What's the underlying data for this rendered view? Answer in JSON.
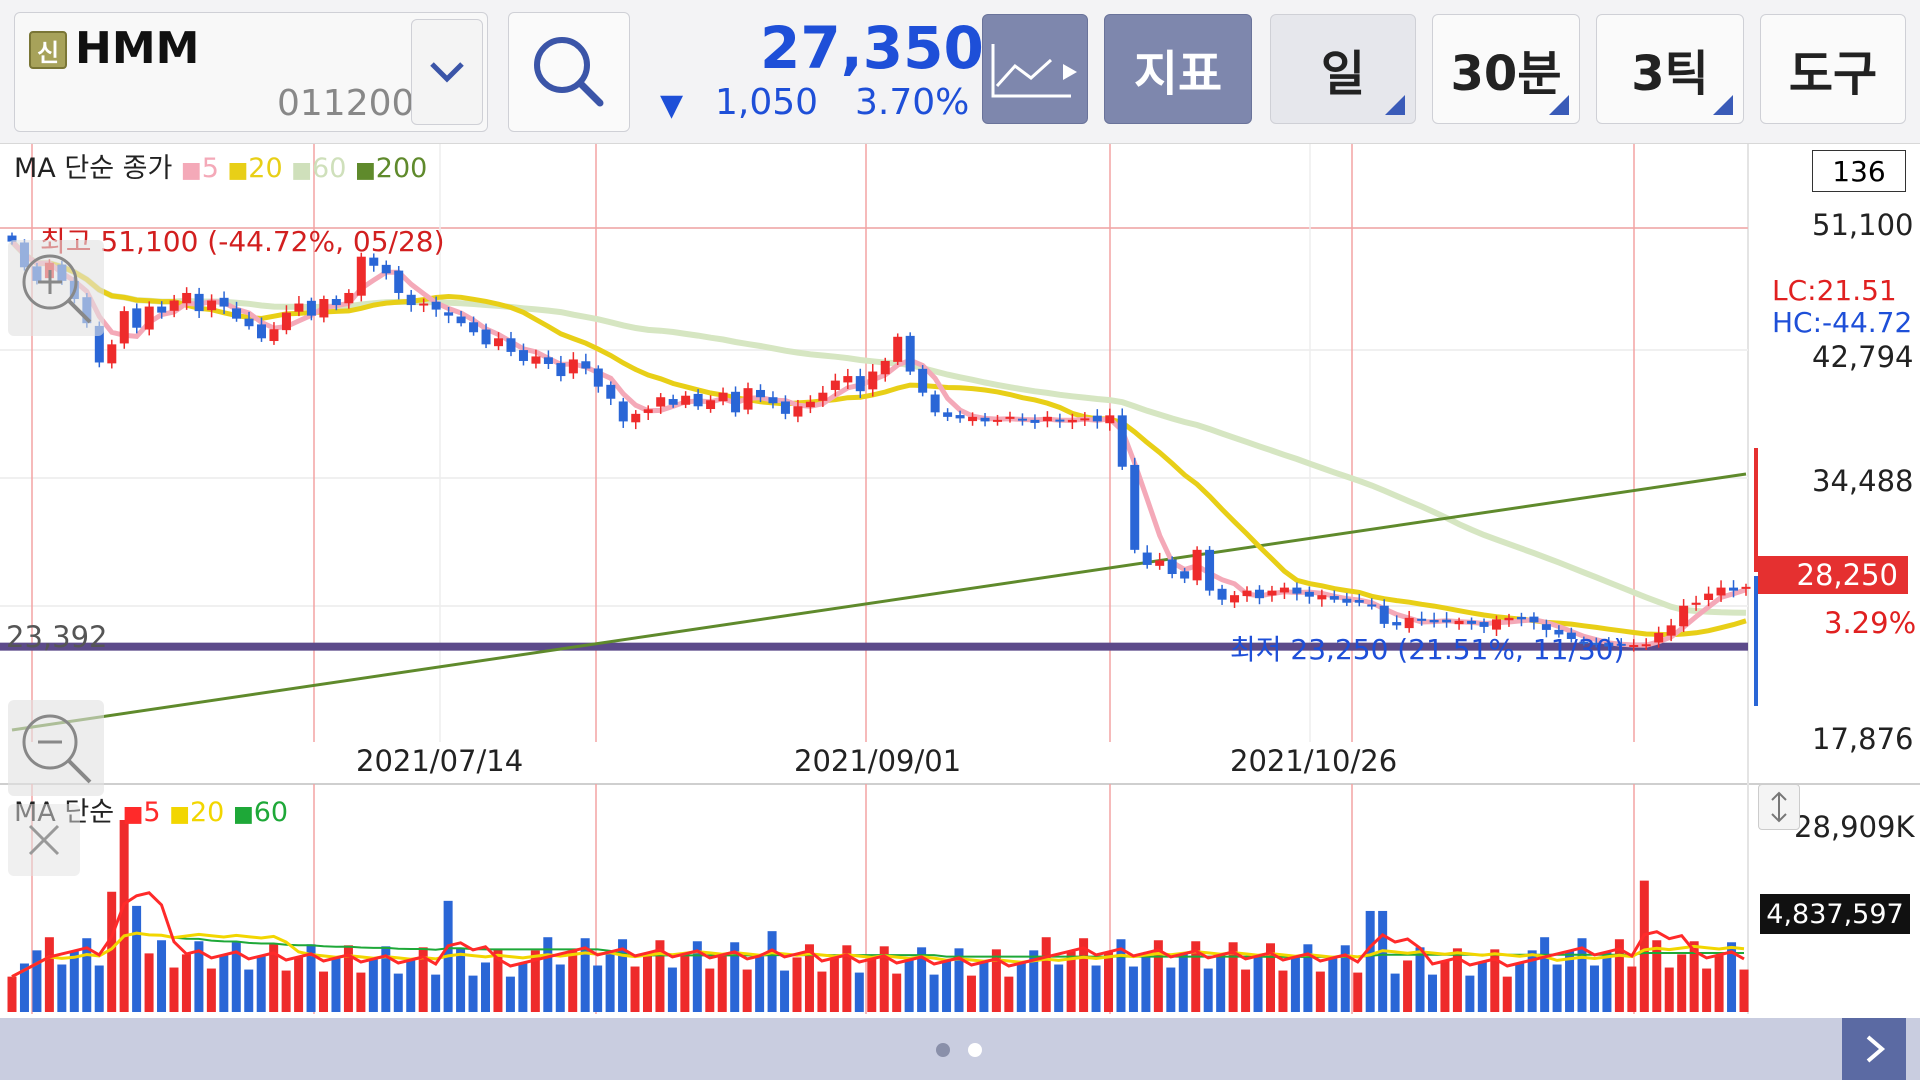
{
  "toolbar": {
    "symbol_badge": "신",
    "symbol_name": "HMM",
    "symbol_code": "011200",
    "price": "27,350",
    "direction": "▼",
    "change": "1,050",
    "change_pct": "3.70%",
    "indicator_label": "지표",
    "day_label": "일",
    "min_label": "30분",
    "tick_label": "3틱",
    "tools_label": "도구"
  },
  "price_panel": {
    "legend_title": "MA 단순 종가",
    "ma": [
      {
        "label": "5",
        "color": "#f4a9b8"
      },
      {
        "label": "20",
        "color": "#e8cf17"
      },
      {
        "label": "60",
        "color": "#d6e6c2"
      },
      {
        "label": "200",
        "color": "#5f8a2c"
      }
    ],
    "high_note": "최고 51,100 (-44.72%, 05/28)",
    "low_note": "최저 23,250 (21.51%, 11/30)",
    "hline_label": "23,392",
    "y_ticks": [
      "51,100",
      "42,794",
      "34,488",
      "17,876"
    ],
    "count_box": "136",
    "lc": "LC:21.51",
    "hc": "HC:-44.72",
    "cur_price_tag": "28,250",
    "cur_pct": "3.29%",
    "dates": [
      "2021/07/14",
      "2021/09/01",
      "2021/10/26"
    ]
  },
  "volume_panel": {
    "legend_title": "MA 단순",
    "ma": [
      {
        "label": "5",
        "color": "#ff2a2a"
      },
      {
        "label": "20",
        "color": "#f2d600"
      },
      {
        "label": "60",
        "color": "#1ea838"
      }
    ],
    "max_label": "28,909K",
    "cur_volume": "4,837,597"
  },
  "chart_data": {
    "type": "candlestick",
    "ylim": [
      17876,
      51100
    ],
    "closes": [
      50200,
      48500,
      47600,
      48800,
      47600,
      46400,
      44800,
      42200,
      43400,
      45600,
      44500,
      45900,
      45500,
      46300,
      46800,
      45600,
      46300,
      45900,
      45100,
      44600,
      43800,
      44400,
      45500,
      46100,
      45300,
      46400,
      46000,
      46800,
      49200,
      48600,
      48100,
      46800,
      46000,
      46100,
      45700,
      45300,
      44800,
      44200,
      43400,
      43800,
      42900,
      42300,
      42600,
      42100,
      41300,
      42400,
      41800,
      40600,
      39800,
      38300,
      38800,
      39100,
      39900,
      39400,
      40000,
      39300,
      39700,
      40200,
      38900,
      40500,
      39900,
      39500,
      38800,
      39300,
      39600,
      40200,
      41000,
      41300,
      40300,
      41600,
      42300,
      43900,
      41600,
      40200,
      38900,
      38600,
      38500,
      38600,
      38300,
      38400,
      38600,
      38400,
      38200,
      38600,
      38300,
      38400,
      38500,
      38300,
      38700,
      35300,
      29800,
      28800,
      29100,
      28200,
      27900,
      29800,
      27100,
      26500,
      26800,
      27100,
      26600,
      27100,
      27300,
      26900,
      26700,
      26800,
      26500,
      26300,
      26300,
      26100,
      24900,
      24800,
      25300,
      25100,
      25000,
      25000,
      25100,
      24900,
      24700,
      25200,
      25300,
      25200,
      25000,
      24500,
      24200,
      23900,
      23700,
      23600,
      23400,
      23500,
      23500,
      23550,
      24300,
      24800,
      26100,
      26300,
      26900,
      27300,
      27100,
      27350
    ]
  }
}
